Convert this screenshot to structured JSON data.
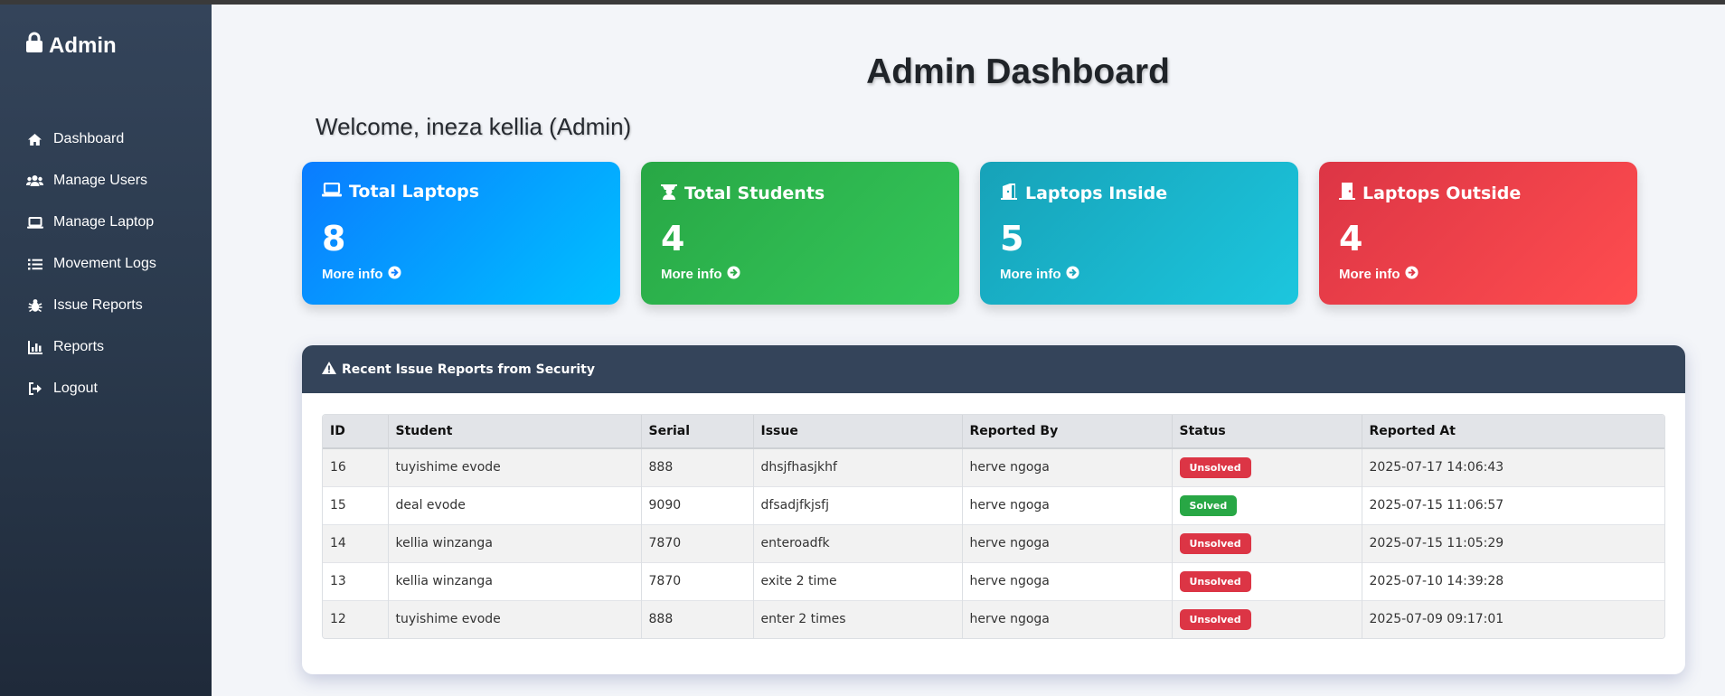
{
  "brand": {
    "label": "Admin",
    "icon": "lock-icon"
  },
  "nav": [
    {
      "label": "Dashboard",
      "icon": "home-icon"
    },
    {
      "label": "Manage Users",
      "icon": "users-icon"
    },
    {
      "label": "Manage Laptop",
      "icon": "laptop-icon"
    },
    {
      "label": "Movement Logs",
      "icon": "list-icon"
    },
    {
      "label": "Issue Reports",
      "icon": "bug-icon"
    },
    {
      "label": "Reports",
      "icon": "chart-icon"
    },
    {
      "label": "Logout",
      "icon": "logout-icon"
    }
  ],
  "page_title": "Admin Dashboard",
  "welcome": "Welcome, ineza kellia (Admin)",
  "cards": [
    {
      "title": "Total Laptops",
      "value": "8",
      "more": "More info",
      "icon": "laptop-icon"
    },
    {
      "title": "Total Students",
      "value": "4",
      "more": "More info",
      "icon": "graduation-cap-icon"
    },
    {
      "title": "Laptops Inside",
      "value": "5",
      "more": "More info",
      "icon": "door-open-icon"
    },
    {
      "title": "Laptops Outside",
      "value": "4",
      "more": "More info",
      "icon": "door-closed-icon"
    }
  ],
  "issues": {
    "title": "Recent Issue Reports from Security",
    "icon": "warning-icon",
    "columns": [
      "ID",
      "Student",
      "Serial",
      "Issue",
      "Reported By",
      "Status",
      "Reported At"
    ],
    "rows": [
      {
        "id": "16",
        "student": "tuyishime evode",
        "serial": "888",
        "issue": "dhsjfhasjkhf",
        "reported_by": "herve ngoga",
        "status": "Unsolved",
        "reported_at": "2025-07-17 14:06:43"
      },
      {
        "id": "15",
        "student": "deal evode",
        "serial": "9090",
        "issue": "dfsadjfkjsfj",
        "reported_by": "herve ngoga",
        "status": "Solved",
        "reported_at": "2025-07-15 11:06:57"
      },
      {
        "id": "14",
        "student": "kellia winzanga",
        "serial": "7870",
        "issue": "enteroadfk",
        "reported_by": "herve ngoga",
        "status": "Unsolved",
        "reported_at": "2025-07-15 11:05:29"
      },
      {
        "id": "13",
        "student": "kellia winzanga",
        "serial": "7870",
        "issue": "exite 2 time",
        "reported_by": "herve ngoga",
        "status": "Unsolved",
        "reported_at": "2025-07-10 14:39:28"
      },
      {
        "id": "12",
        "student": "tuyishime evode",
        "serial": "888",
        "issue": "enter 2 times",
        "reported_by": "herve ngoga",
        "status": "Unsolved",
        "reported_at": "2025-07-09 09:17:01"
      }
    ]
  },
  "colors": {
    "solved": "#28a745",
    "unsolved": "#dc3545",
    "sidebar": "#2a394c"
  }
}
